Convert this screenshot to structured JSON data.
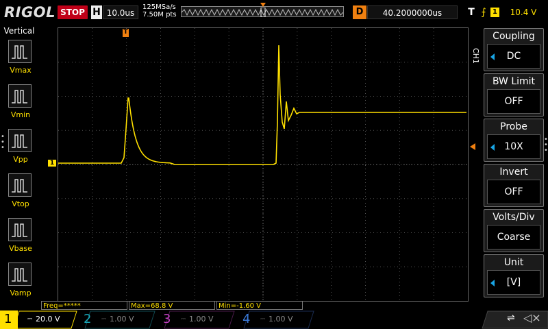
{
  "header": {
    "brand": "RIGOL",
    "run_state": "STOP",
    "timebase_label": "H",
    "timebase_value": "10.0us",
    "sample_rate": "125MSa/s",
    "memory_depth": "7.50M pts",
    "delay_label": "D",
    "delay_value": "40.2000000us",
    "trigger_label": "T",
    "trigger_edge_icon": "rising-edge-icon",
    "trigger_source": "1",
    "trigger_level": "10.4 V"
  },
  "left_menu": {
    "title": "Vertical",
    "items": [
      {
        "label": "Vmax",
        "icon": "vmax-icon"
      },
      {
        "label": "Vmin",
        "icon": "vmin-icon"
      },
      {
        "label": "Vpp",
        "icon": "vpp-icon"
      },
      {
        "label": "Vtop",
        "icon": "vtop-icon"
      },
      {
        "label": "Vbase",
        "icon": "vbase-icon"
      },
      {
        "label": "Vamp",
        "icon": "vamp-icon"
      }
    ]
  },
  "right_menu": {
    "channel_tag": "CH1",
    "items": [
      {
        "title": "Coupling",
        "value": "DC",
        "has_arrow": true
      },
      {
        "title": "BW Limit",
        "value": "OFF",
        "has_arrow": false
      },
      {
        "title": "Probe",
        "value": "10X",
        "has_arrow": true
      },
      {
        "title": "Invert",
        "value": "OFF",
        "has_arrow": false
      },
      {
        "title": "Volts/Div",
        "value": "Coarse",
        "has_arrow": false
      },
      {
        "title": "Unit",
        "value": "[V]",
        "has_arrow": true
      }
    ]
  },
  "measurements": {
    "freq": "Freq=*****",
    "max": "Max=68.8 V",
    "min": "Min=-1.60 V"
  },
  "channels": [
    {
      "num": "1",
      "scale": "20.0 V",
      "color": "#ffe000",
      "active": true
    },
    {
      "num": "2",
      "scale": "1.00 V",
      "color": "#19a6b8",
      "active": false
    },
    {
      "num": "3",
      "scale": "1.00 V",
      "color": "#c040c0",
      "active": false
    },
    {
      "num": "4",
      "scale": "1.00 V",
      "color": "#3a7ad8",
      "active": false
    }
  ],
  "markers": {
    "ch1_ground": "1",
    "trigger_time": "T"
  },
  "colors": {
    "ch1": "#ffe000",
    "accent_orange": "#f08010",
    "menu_arrow": "#19a6e6",
    "stop_red": "#c00018"
  }
}
